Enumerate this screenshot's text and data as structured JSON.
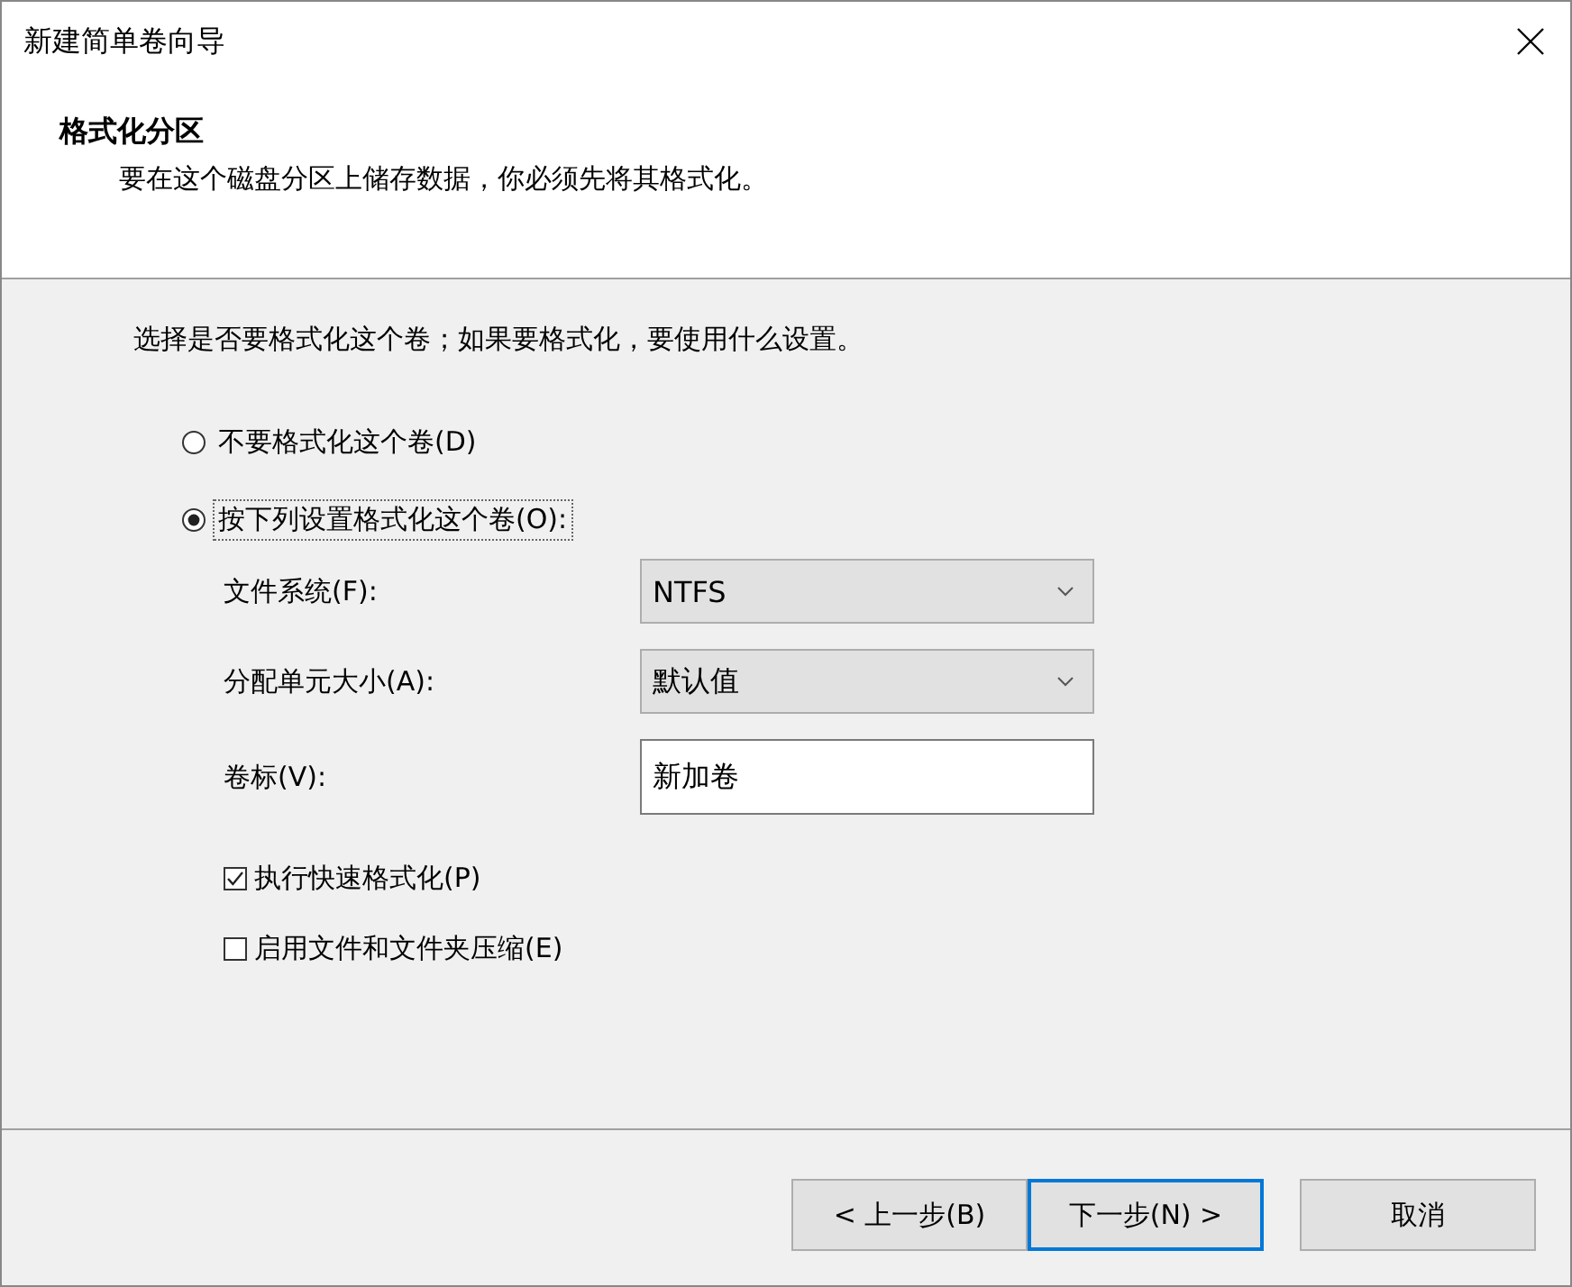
{
  "window": {
    "title": "新建简单卷向导"
  },
  "header": {
    "title": "格式化分区",
    "subtitle": "要在这个磁盘分区上储存数据，你必须先将其格式化。"
  },
  "instruction": "选择是否要格式化这个卷；如果要格式化，要使用什么设置。",
  "options": [
    {
      "label": "不要格式化这个卷(D)",
      "selected": false
    },
    {
      "label": "按下列设置格式化这个卷(O):",
      "selected": true
    }
  ],
  "settings": [
    {
      "kind": "dropdown",
      "label": "文件系统(F):",
      "value": "NTFS"
    },
    {
      "kind": "dropdown",
      "label": "分配单元大小(A):",
      "value": "默认值"
    },
    {
      "kind": "text",
      "label": "卷标(V):",
      "value": "新加卷"
    }
  ],
  "checkboxes": [
    {
      "label": "执行快速格式化(P)",
      "checked": true
    },
    {
      "label": "启用文件和文件夹压缩(E)",
      "checked": false
    }
  ],
  "buttons": [
    {
      "label": "< 上一步(B)",
      "focused": false
    },
    {
      "label": "下一步(N) >",
      "focused": true
    },
    {
      "label": "取消",
      "focused": false
    }
  ]
}
